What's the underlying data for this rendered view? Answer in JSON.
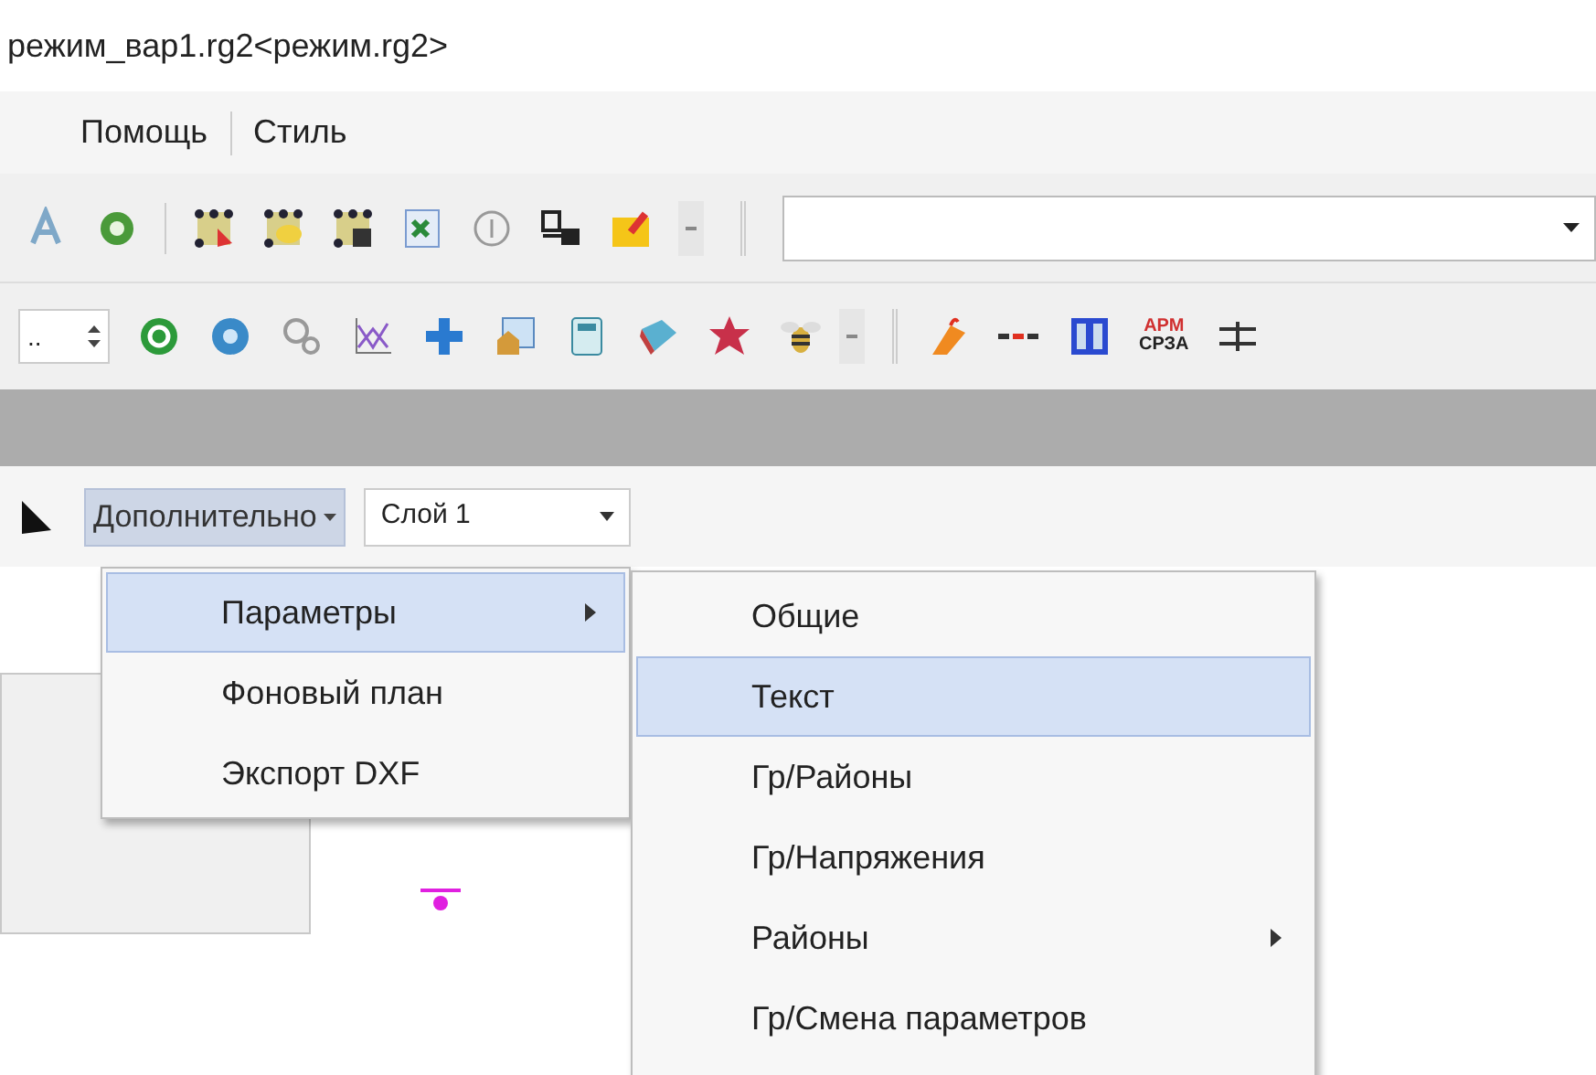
{
  "window": {
    "title": "режим_вар1.rg2<режим.rg2>"
  },
  "menu_bar": [
    "Помощь",
    "Стиль"
  ],
  "toolbar_2": {
    "spin_value": "..",
    "arm_label_top": "АРМ",
    "arm_label_bottom": "СРЗА"
  },
  "toolbar_3": {
    "menu_button": "Дополнительно",
    "layer_combo": "Слой 1"
  },
  "dropdown_menu": [
    {
      "label": "Параметры",
      "submenu": true,
      "selected": true
    },
    {
      "label": "Фоновый план",
      "submenu": false,
      "selected": false
    },
    {
      "label": "Экспорт DXF",
      "submenu": false,
      "selected": false
    }
  ],
  "submenu": [
    {
      "label": "Общие",
      "submenu": false,
      "selected": false
    },
    {
      "label": "Текст",
      "submenu": false,
      "selected": true
    },
    {
      "label": "Гр/Районы",
      "submenu": false,
      "selected": false
    },
    {
      "label": "Гр/Напряжения",
      "submenu": false,
      "selected": false
    },
    {
      "label": "Районы",
      "submenu": true,
      "selected": false
    },
    {
      "label": "Гр/Смена параметров",
      "submenu": false,
      "selected": false
    }
  ]
}
